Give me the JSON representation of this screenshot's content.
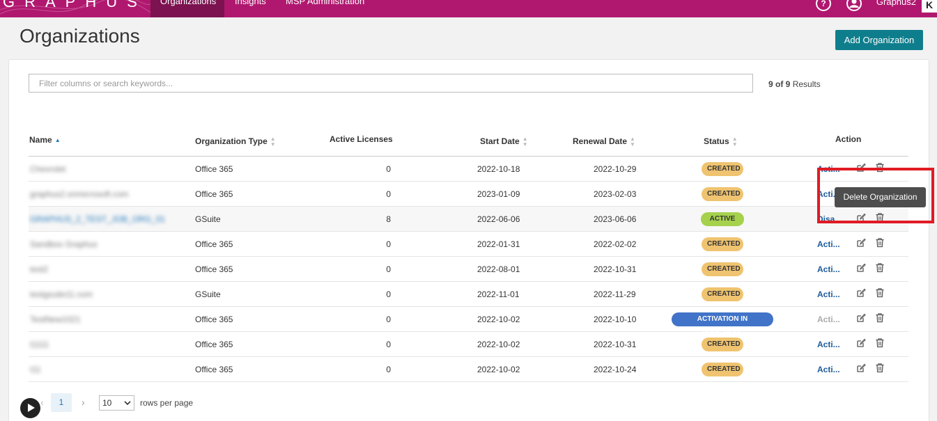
{
  "nav": {
    "logo": "GRAPHUS",
    "items": [
      "Organizations",
      "Insights",
      "MSP Administration"
    ],
    "user": "Graphus2",
    "brand": "K"
  },
  "page": {
    "title": "Organizations",
    "add_button": "Add Organization"
  },
  "search": {
    "placeholder": "Filter columns or search keywords...",
    "results_count": "9 of 9",
    "results_label": "Results"
  },
  "table": {
    "headers": {
      "name": "Name",
      "type": "Organization Type",
      "licenses": "Active Licenses",
      "start": "Start Date",
      "renewal": "Renewal Date",
      "status": "Status",
      "action": "Action"
    },
    "rows": [
      {
        "name": "Chevrolet",
        "type": "Office 365",
        "licenses": "0",
        "start": "2022-10-18",
        "renewal": "2022-10-29",
        "status": "CREATED",
        "action": "Acti..."
      },
      {
        "name": "graphus2.onmicrosoft.com",
        "type": "Office 365",
        "licenses": "0",
        "start": "2023-01-09",
        "renewal": "2023-02-03",
        "status": "CREATED",
        "action": "Acti..."
      },
      {
        "name": "GRAPHUS_2_TEST_JOB_ORG_01",
        "type": "GSuite",
        "licenses": "8",
        "start": "2022-06-06",
        "renewal": "2023-06-06",
        "status": "ACTIVE",
        "action": "Disa..."
      },
      {
        "name": "Sandbox Graphus",
        "type": "Office 365",
        "licenses": "0",
        "start": "2022-01-31",
        "renewal": "2022-02-02",
        "status": "CREATED",
        "action": "Acti..."
      },
      {
        "name": "test2",
        "type": "Office 365",
        "licenses": "0",
        "start": "2022-08-01",
        "renewal": "2022-10-31",
        "status": "CREATED",
        "action": "Acti..."
      },
      {
        "name": "testgsuite11.com",
        "type": "GSuite",
        "licenses": "0",
        "start": "2022-11-01",
        "renewal": "2022-11-29",
        "status": "CREATED",
        "action": "Acti..."
      },
      {
        "name": "TestNew1021",
        "type": "Office 365",
        "licenses": "0",
        "start": "2022-10-02",
        "renewal": "2022-10-10",
        "status": "ACTIVATION IN PROGRESS",
        "action": "Acti..."
      },
      {
        "name": "t1111",
        "type": "Office 365",
        "licenses": "0",
        "start": "2022-10-02",
        "renewal": "2022-10-31",
        "status": "CREATED",
        "action": "Acti..."
      },
      {
        "name": "t11",
        "type": "Office 365",
        "licenses": "0",
        "start": "2022-10-02",
        "renewal": "2022-10-24",
        "status": "CREATED",
        "action": "Acti..."
      }
    ]
  },
  "tooltip": "Delete Organization",
  "pagination": {
    "current": "1",
    "page_size": "10",
    "label": "rows per page"
  },
  "colors": {
    "nav_bg": "#b0186f",
    "accent": "#0f7e8c",
    "created": "#efc36f",
    "active": "#a5d14c",
    "progress": "#4173c8",
    "highlight": "#e01b24"
  }
}
